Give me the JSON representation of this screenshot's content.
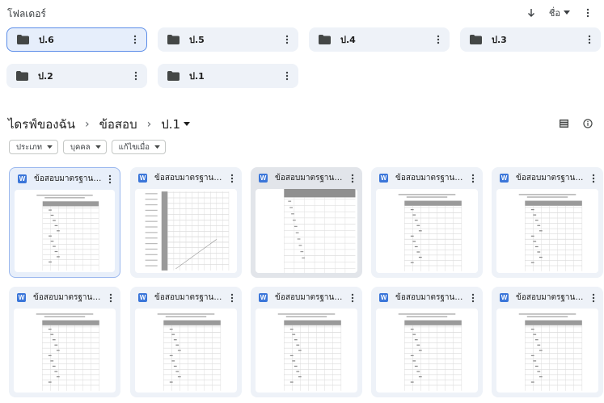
{
  "folders_section": {
    "title": "โฟลเดอร์",
    "sort_label": "ชื่อ"
  },
  "folders": [
    {
      "name": "ป.6",
      "selected": true
    },
    {
      "name": "ป.5"
    },
    {
      "name": "ป.4"
    },
    {
      "name": "ป.3"
    },
    {
      "name": "ป.2"
    },
    {
      "name": "ป.1"
    }
  ],
  "breadcrumb": {
    "root": "ไดรฟ์ของฉัน",
    "parent": "ข้อสอบ",
    "current": "ป.1"
  },
  "filters": [
    {
      "label": "ประเภท"
    },
    {
      "label": "บุคคล"
    },
    {
      "label": "แก้ไขเมื่อ"
    }
  ],
  "files": [
    {
      "name": "ข้อสอบมาตรฐานชั้นปี...",
      "type_icon": "W"
    },
    {
      "name": "ข้อสอบมาตรฐานชั้นปี...",
      "type_icon": "W"
    },
    {
      "name": "ข้อสอบมาตรฐานชั้นปี...",
      "type_icon": "W"
    },
    {
      "name": "ข้อสอบมาตรฐานชั้นปี...",
      "type_icon": "W"
    },
    {
      "name": "ข้อสอบมาตรฐานชั้นปี...",
      "type_icon": "W"
    },
    {
      "name": "ข้อสอบมาตรฐานชั้นปี...",
      "type_icon": "W"
    },
    {
      "name": "ข้อสอบมาตรฐานชั้นปี...",
      "type_icon": "W"
    },
    {
      "name": "ข้อสอบมาตรฐานชั้นปี...",
      "type_icon": "W"
    },
    {
      "name": "ข้อสอบมาตรฐานชั้นปี...",
      "type_icon": "W"
    },
    {
      "name": "ข้อสอบมาตรฐานชั้นปี...",
      "type_icon": "W"
    }
  ]
}
